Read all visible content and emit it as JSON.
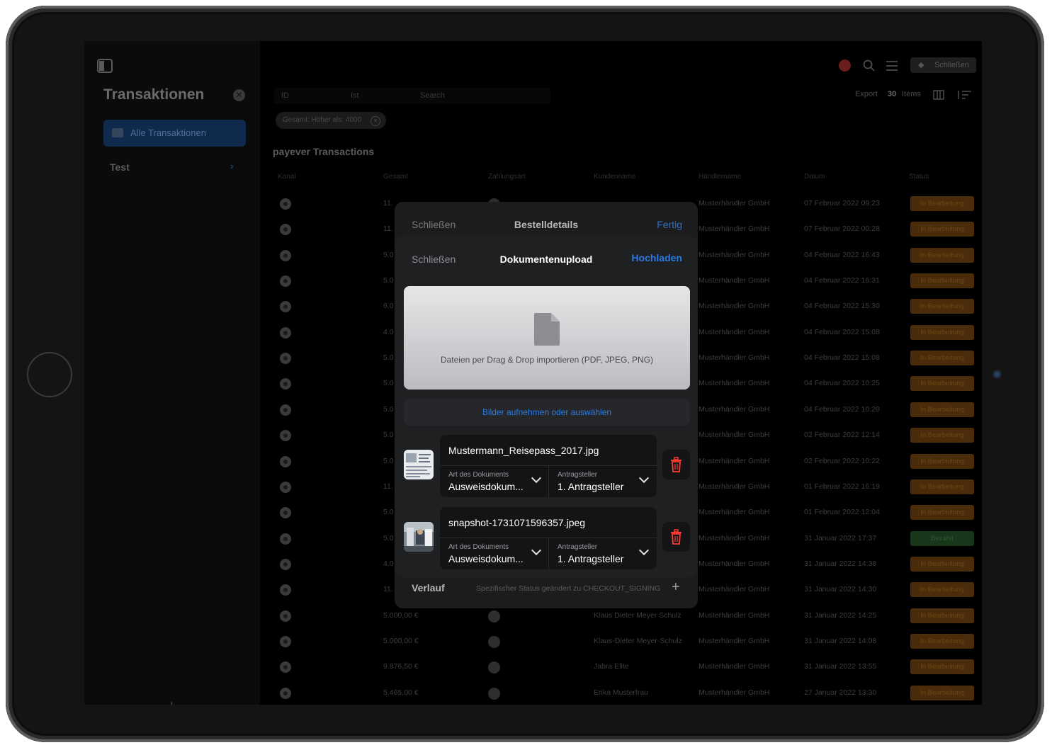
{
  "topbar": {
    "close_label": "Schließen"
  },
  "sidebar": {
    "title": "Transaktionen",
    "items": [
      {
        "label": "Alle Transaktionen"
      },
      {
        "label": "Test"
      }
    ]
  },
  "toolbar": {
    "id_placeholder": "ID",
    "ist_placeholder": "Ist",
    "search_placeholder": "Search",
    "filter_chip": "Gesamt: Höher als: 4000",
    "export_label": "Export",
    "items_count": "30",
    "items_label": "Items"
  },
  "table": {
    "title": "payever Transactions",
    "headers": [
      "Kanal",
      "Gesamt",
      "Zahlungsart",
      "Kundenname",
      "Händlername",
      "Datum",
      "Status"
    ],
    "rows": [
      {
        "total": "11.",
        "customer": "",
        "merchant": "Musterhändler GmbH",
        "date": "07 Februar 2022 09:23",
        "status": "In Bearbeitung"
      },
      {
        "total": "11.",
        "customer": "",
        "merchant": "Musterhändler GmbH",
        "date": "07 Februar 2022 00:28",
        "status": "In Bearbeitung"
      },
      {
        "total": "5.0",
        "customer": "",
        "merchant": "Musterhändler GmbH",
        "date": "04 Februar 2022 16:43",
        "status": "In Bearbeitung"
      },
      {
        "total": "5.0",
        "customer": "",
        "merchant": "Musterhändler GmbH",
        "date": "04 Februar 2022 16:31",
        "status": "In Bearbeitung"
      },
      {
        "total": "6.0",
        "customer": "",
        "merchant": "Musterhändler GmbH",
        "date": "04 Februar 2022 15:30",
        "status": "In Bearbeitung"
      },
      {
        "total": "4.0",
        "customer": "",
        "merchant": "Musterhändler GmbH",
        "date": "04 Februar 2022 15:08",
        "status": "In Bearbeitung"
      },
      {
        "total": "5.0",
        "customer": "",
        "merchant": "Musterhändler GmbH",
        "date": "04 Februar 2022 15:08",
        "status": "In Bearbeitung"
      },
      {
        "total": "5.0",
        "customer": "",
        "merchant": "Musterhändler GmbH",
        "date": "04 Februar 2022 10:25",
        "status": "In Bearbeitung"
      },
      {
        "total": "5.0",
        "customer": "",
        "merchant": "Musterhändler GmbH",
        "date": "04 Februar 2022 10:20",
        "status": "In Bearbeitung"
      },
      {
        "total": "5.0",
        "customer": "",
        "merchant": "Musterhändler GmbH",
        "date": "02 Februar 2022 12:14",
        "status": "In Bearbeitung"
      },
      {
        "total": "5.0",
        "customer": "",
        "merchant": "Musterhändler GmbH",
        "date": "02 Februar 2022 10:22",
        "status": "In Bearbeitung"
      },
      {
        "total": "11.",
        "customer": "",
        "merchant": "Musterhändler GmbH",
        "date": "01 Februar 2022 16:19",
        "status": "In Bearbeitung"
      },
      {
        "total": "5.0",
        "customer": "",
        "merchant": "Musterhändler GmbH",
        "date": "01 Februar 2022 12:04",
        "status": "In Bearbeitung"
      },
      {
        "total": "5.0",
        "customer": "",
        "merchant": "Musterhändler GmbH",
        "date": "31 Januar 2022 17:37",
        "status": "Bezahlt"
      },
      {
        "total": "4.0",
        "customer": "",
        "merchant": "Musterhändler GmbH",
        "date": "31 Januar 2022 14:38",
        "status": "In Bearbeitung"
      },
      {
        "total": "11.",
        "customer": "",
        "merchant": "Musterhändler GmbH",
        "date": "31 Januar 2022 14:30",
        "status": "In Bearbeitung"
      },
      {
        "total": "5.000,00 €",
        "customer": "Klaus Dieter Meyer Schulz",
        "merchant": "Musterhändler GmbH",
        "date": "31 Januar 2022 14:25",
        "status": "In Bearbeitung"
      },
      {
        "total": "5.000,00 €",
        "customer": "Klaus-Dieter Meyer-Schulz",
        "merchant": "Musterhändler GmbH",
        "date": "31 Januar 2022 14:08",
        "status": "In Bearbeitung"
      },
      {
        "total": "9.876,50 €",
        "customer": "Jabra Elite",
        "merchant": "Musterhändler GmbH",
        "date": "31 Januar 2022 13:55",
        "status": "In Bearbeitung"
      },
      {
        "total": "5.465,00 €",
        "customer": "Erika Musterfrau",
        "merchant": "Musterhändler GmbH",
        "date": "27 Januar 2022 13:30",
        "status": "In Bearbeitung"
      }
    ]
  },
  "order_sheet": {
    "close_label": "Schließen",
    "title": "Bestelldetails",
    "done_label": "Fertig",
    "history_label": "Verlauf",
    "history_status": "Spezifischer Status geändert zu CHECKOUT_SIGNING"
  },
  "upload_sheet": {
    "close_label": "Schließen",
    "title": "Dokumentenupload",
    "upload_label": "Hochladen",
    "dropzone_text": "Dateien per Drag & Drop importieren (PDF, JPEG, PNG)",
    "pick_label": "Bilder aufnehmen oder auswählen",
    "documents": [
      {
        "filename": "Mustermann_Reisepass_2017.jpg",
        "type_label": "Art des Dokuments",
        "type_value": "Ausweisdokum...",
        "applicant_label": "Antragsteller",
        "applicant_value": "1. Antragsteller"
      },
      {
        "filename": "snapshot-1731071596357.jpeg",
        "type_label": "Art des Dokuments",
        "type_value": "Ausweisdokum...",
        "applicant_label": "Antragsteller",
        "applicant_value": "1. Antragsteller"
      }
    ]
  },
  "colors": {
    "accent": "#2a7ae4",
    "status_processing": "#4b2c0a",
    "status_paid": "#17361a",
    "danger": "#ff3b30"
  }
}
